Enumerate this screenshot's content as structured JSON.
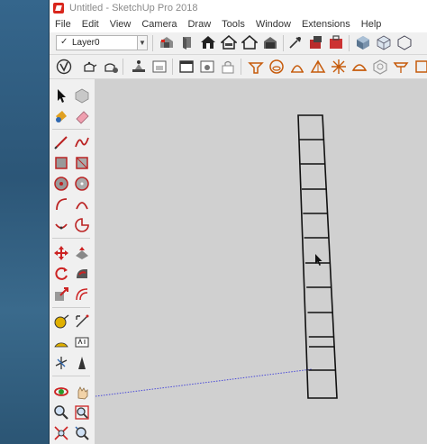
{
  "window": {
    "title": "Untitled - SketchUp Pro 2018"
  },
  "menu": [
    "File",
    "Edit",
    "View",
    "Camera",
    "Draw",
    "Tools",
    "Window",
    "Extensions",
    "Help"
  ],
  "layers": {
    "check": "✓",
    "current": "Layer0"
  },
  "colors": {
    "accent": "#d9261c",
    "viewport": "#d0d0d0",
    "desktop": "#2f5d7f"
  },
  "toolbar1_icons": [
    "magnifier-icon",
    "warehouse-icon",
    "component-icon",
    "house-icon",
    "house-top-icon",
    "house-outline-icon",
    "house-shaded-icon",
    "eyedropper-icon",
    "extension-icon",
    "toolbox-icon",
    "cube-icon",
    "cube-outline-icon"
  ],
  "toolbar2_icons": [
    "style-icon",
    "teapot-icon",
    "teapot-gear-icon",
    "scene-icon",
    "window-icon",
    "layout-icon",
    "window-gear-icon",
    "lock-icon",
    "protractor-icon",
    "section-icon",
    "sandbox-icon",
    "triangle-icon",
    "star-icon",
    "dome-icon",
    "sphere-icon",
    "flip-icon"
  ],
  "left_toolbar_icons": [
    "select-icon",
    "component-make-icon",
    "paint-bucket-icon",
    "eraser-icon",
    "line-icon",
    "freehand-icon",
    "rectangle-icon",
    "rotated-rectangle-icon",
    "circle-icon",
    "polygon-icon",
    "arc-icon",
    "two-point-arc-icon",
    "three-point-arc-icon",
    "pie-icon",
    "move-icon",
    "push-pull-icon",
    "rotate-icon",
    "follow-me-icon",
    "scale-icon",
    "offset-icon",
    "tape-measure-icon",
    "dimension-icon",
    "protractor-icon",
    "text-icon",
    "axes-icon",
    "3d-text-icon",
    "orbit-icon",
    "pan-icon",
    "zoom-icon",
    "zoom-window-icon",
    "zoom-extents-icon",
    "previous-view-icon"
  ]
}
